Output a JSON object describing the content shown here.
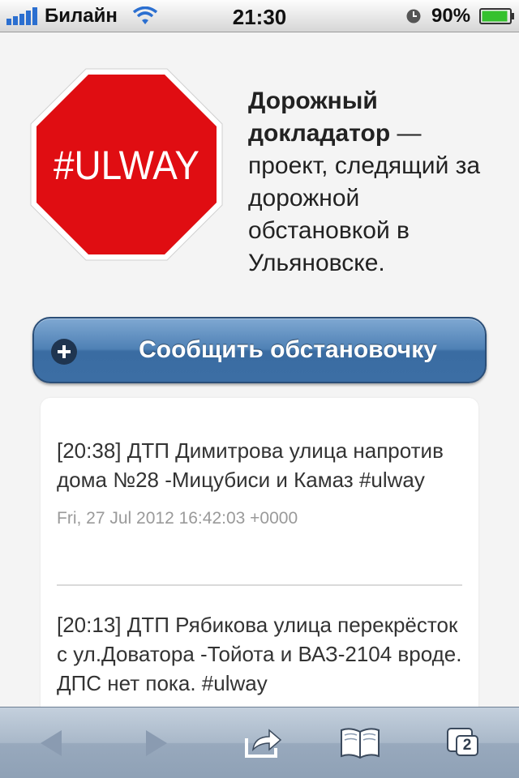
{
  "status_bar": {
    "carrier": "Билайн",
    "time": "21:30",
    "battery_percent": "90%",
    "icons": [
      "signal-icon",
      "wifi-icon",
      "alarm-icon",
      "battery-icon"
    ]
  },
  "logo": {
    "text": "#ULWAY",
    "color": "#e00d12"
  },
  "intro": {
    "title": "Дорожный докладатор",
    "description": " — проект, следящий за дорожной обстановкой в Ульяновске."
  },
  "report_button": {
    "label": "Сообщить обстановочку",
    "icon": "plus-circle-icon"
  },
  "feed": {
    "items": [
      {
        "text": "[20:38] ДТП Димитрова улица напротив дома №28 -Мицубиси и Камаз #ulway",
        "date": "Fri, 27 Jul 2012 16:42:03 +0000"
      },
      {
        "text": "[20:13] ДТП Рябикова улица перекрёсток с ул.Доватора -Тойота и ВАЗ-2104 вроде. ДПС нет пока. #ulway"
      }
    ]
  },
  "toolbar": {
    "tab_count": "2",
    "icons": [
      "back-arrow-icon",
      "forward-arrow-icon",
      "share-icon",
      "bookmarks-icon",
      "tabs-icon"
    ]
  },
  "colors": {
    "button_blue": "#4f81b5",
    "toolbar": "#a9b8c9",
    "stop_red": "#e00d12"
  }
}
